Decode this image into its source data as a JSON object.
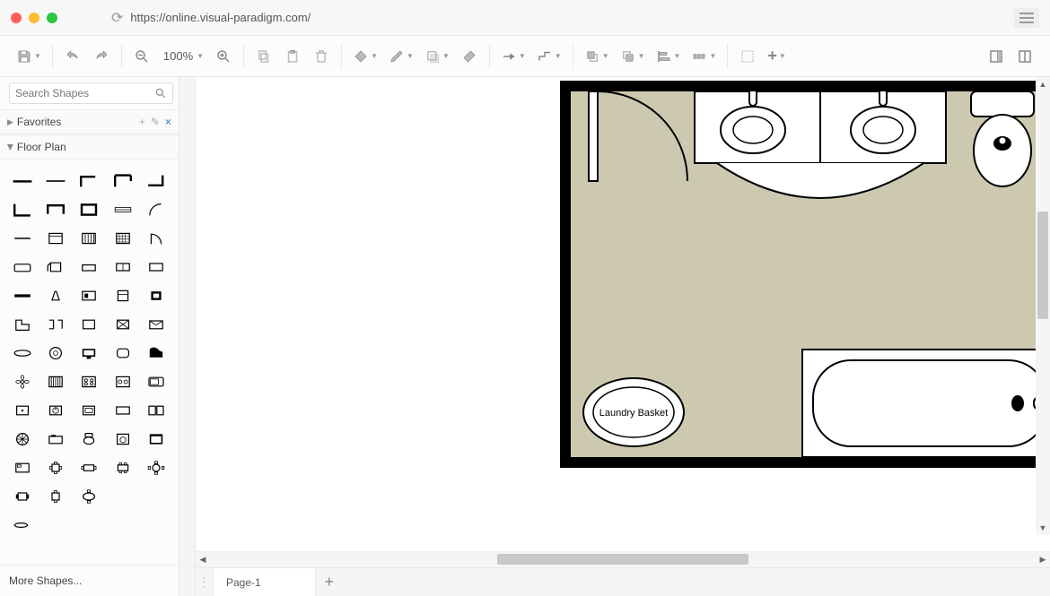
{
  "browser": {
    "url": "https://online.visual-paradigm.com/"
  },
  "toolbar": {
    "zoom_label": "100%"
  },
  "sidebar": {
    "search_placeholder": "Search Shapes",
    "favorites_label": "Favorites",
    "floorplan_label": "Floor Plan",
    "more_shapes_label": "More Shapes..."
  },
  "canvas": {
    "laundry_label": "Laundry Basket"
  },
  "tabs": {
    "page1": "Page-1"
  },
  "colors": {
    "floor": "#cdc9b0",
    "wall": "#000000"
  }
}
